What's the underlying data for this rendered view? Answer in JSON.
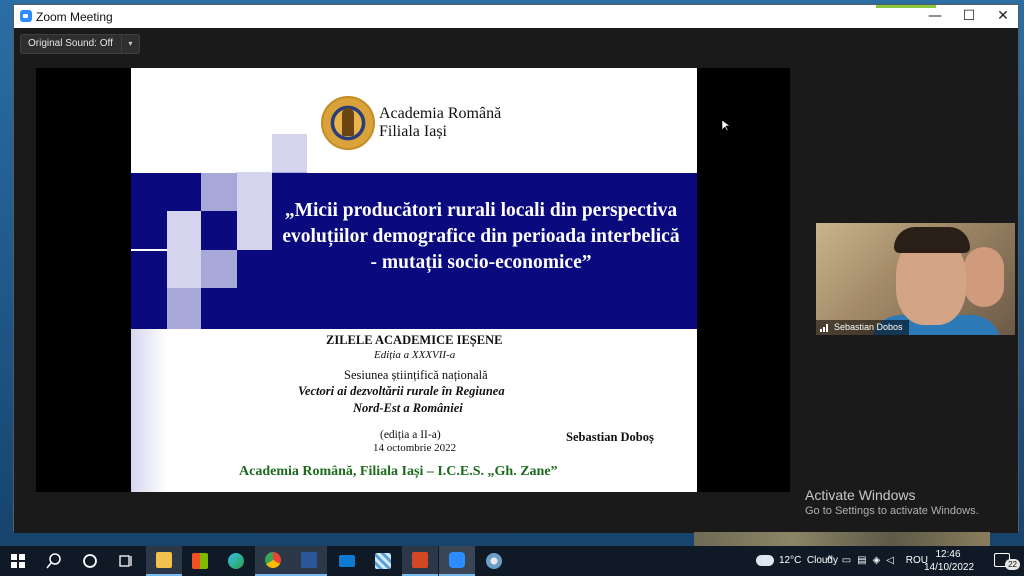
{
  "window": {
    "title": "Zoom Meeting",
    "minimize_glyph": "—",
    "maximize_glyph": "☐",
    "close_glyph": "✕",
    "title_icon": "zoom-icon"
  },
  "toolbar": {
    "original_sound_label": "Original Sound: Off",
    "dropdown_glyph": "▾"
  },
  "slide": {
    "org_line1": "Academia Română",
    "org_line2": "Filiala Iași",
    "title": "„Micii producători rurali locali din perspectiva evoluțiilor demografice din perioada interbelică - mutații socio-economice”",
    "event_name": "ZILELE ACADEMICE IEȘENE",
    "event_edition": "Ediția a XXXVII-a",
    "session_label": "Sesiunea științifică națională",
    "session_title_1": "Vectori ai dezvoltării rurale în Regiunea",
    "session_title_2": "Nord-Est a României",
    "session_edition": "(ediția a II-a)",
    "date": "14 octombrie 2022",
    "author": "Sebastian Doboș",
    "footer": "Academia Română, Filiala Iași – I.C.E.S. „Gh. Zane”",
    "colors": {
      "banner": "#0a0a7e",
      "footer_text": "#1d6b1d",
      "square": "#a7a7d8"
    }
  },
  "participant": {
    "name": "Sebastian Dobos"
  },
  "watermark": {
    "line1": "Activate Windows",
    "line2": "Go to Settings to activate Windows."
  },
  "taskbar": {
    "apps": [
      {
        "name": "start-icon"
      },
      {
        "name": "search-icon"
      },
      {
        "name": "cortana-icon"
      },
      {
        "name": "task-view-icon"
      },
      {
        "name": "file-explorer-icon"
      },
      {
        "name": "store-icon"
      },
      {
        "name": "edge-icon"
      },
      {
        "name": "chrome-icon"
      },
      {
        "name": "word-icon"
      },
      {
        "name": "mail-icon"
      },
      {
        "name": "snip-icon"
      },
      {
        "name": "powerpoint-icon"
      },
      {
        "name": "zoom-icon"
      },
      {
        "name": "app-icon"
      }
    ],
    "weather": "12°C  Cloudy",
    "language": "ROU",
    "time": "12:46",
    "date": "14/10/2022",
    "notification_count": "22"
  }
}
